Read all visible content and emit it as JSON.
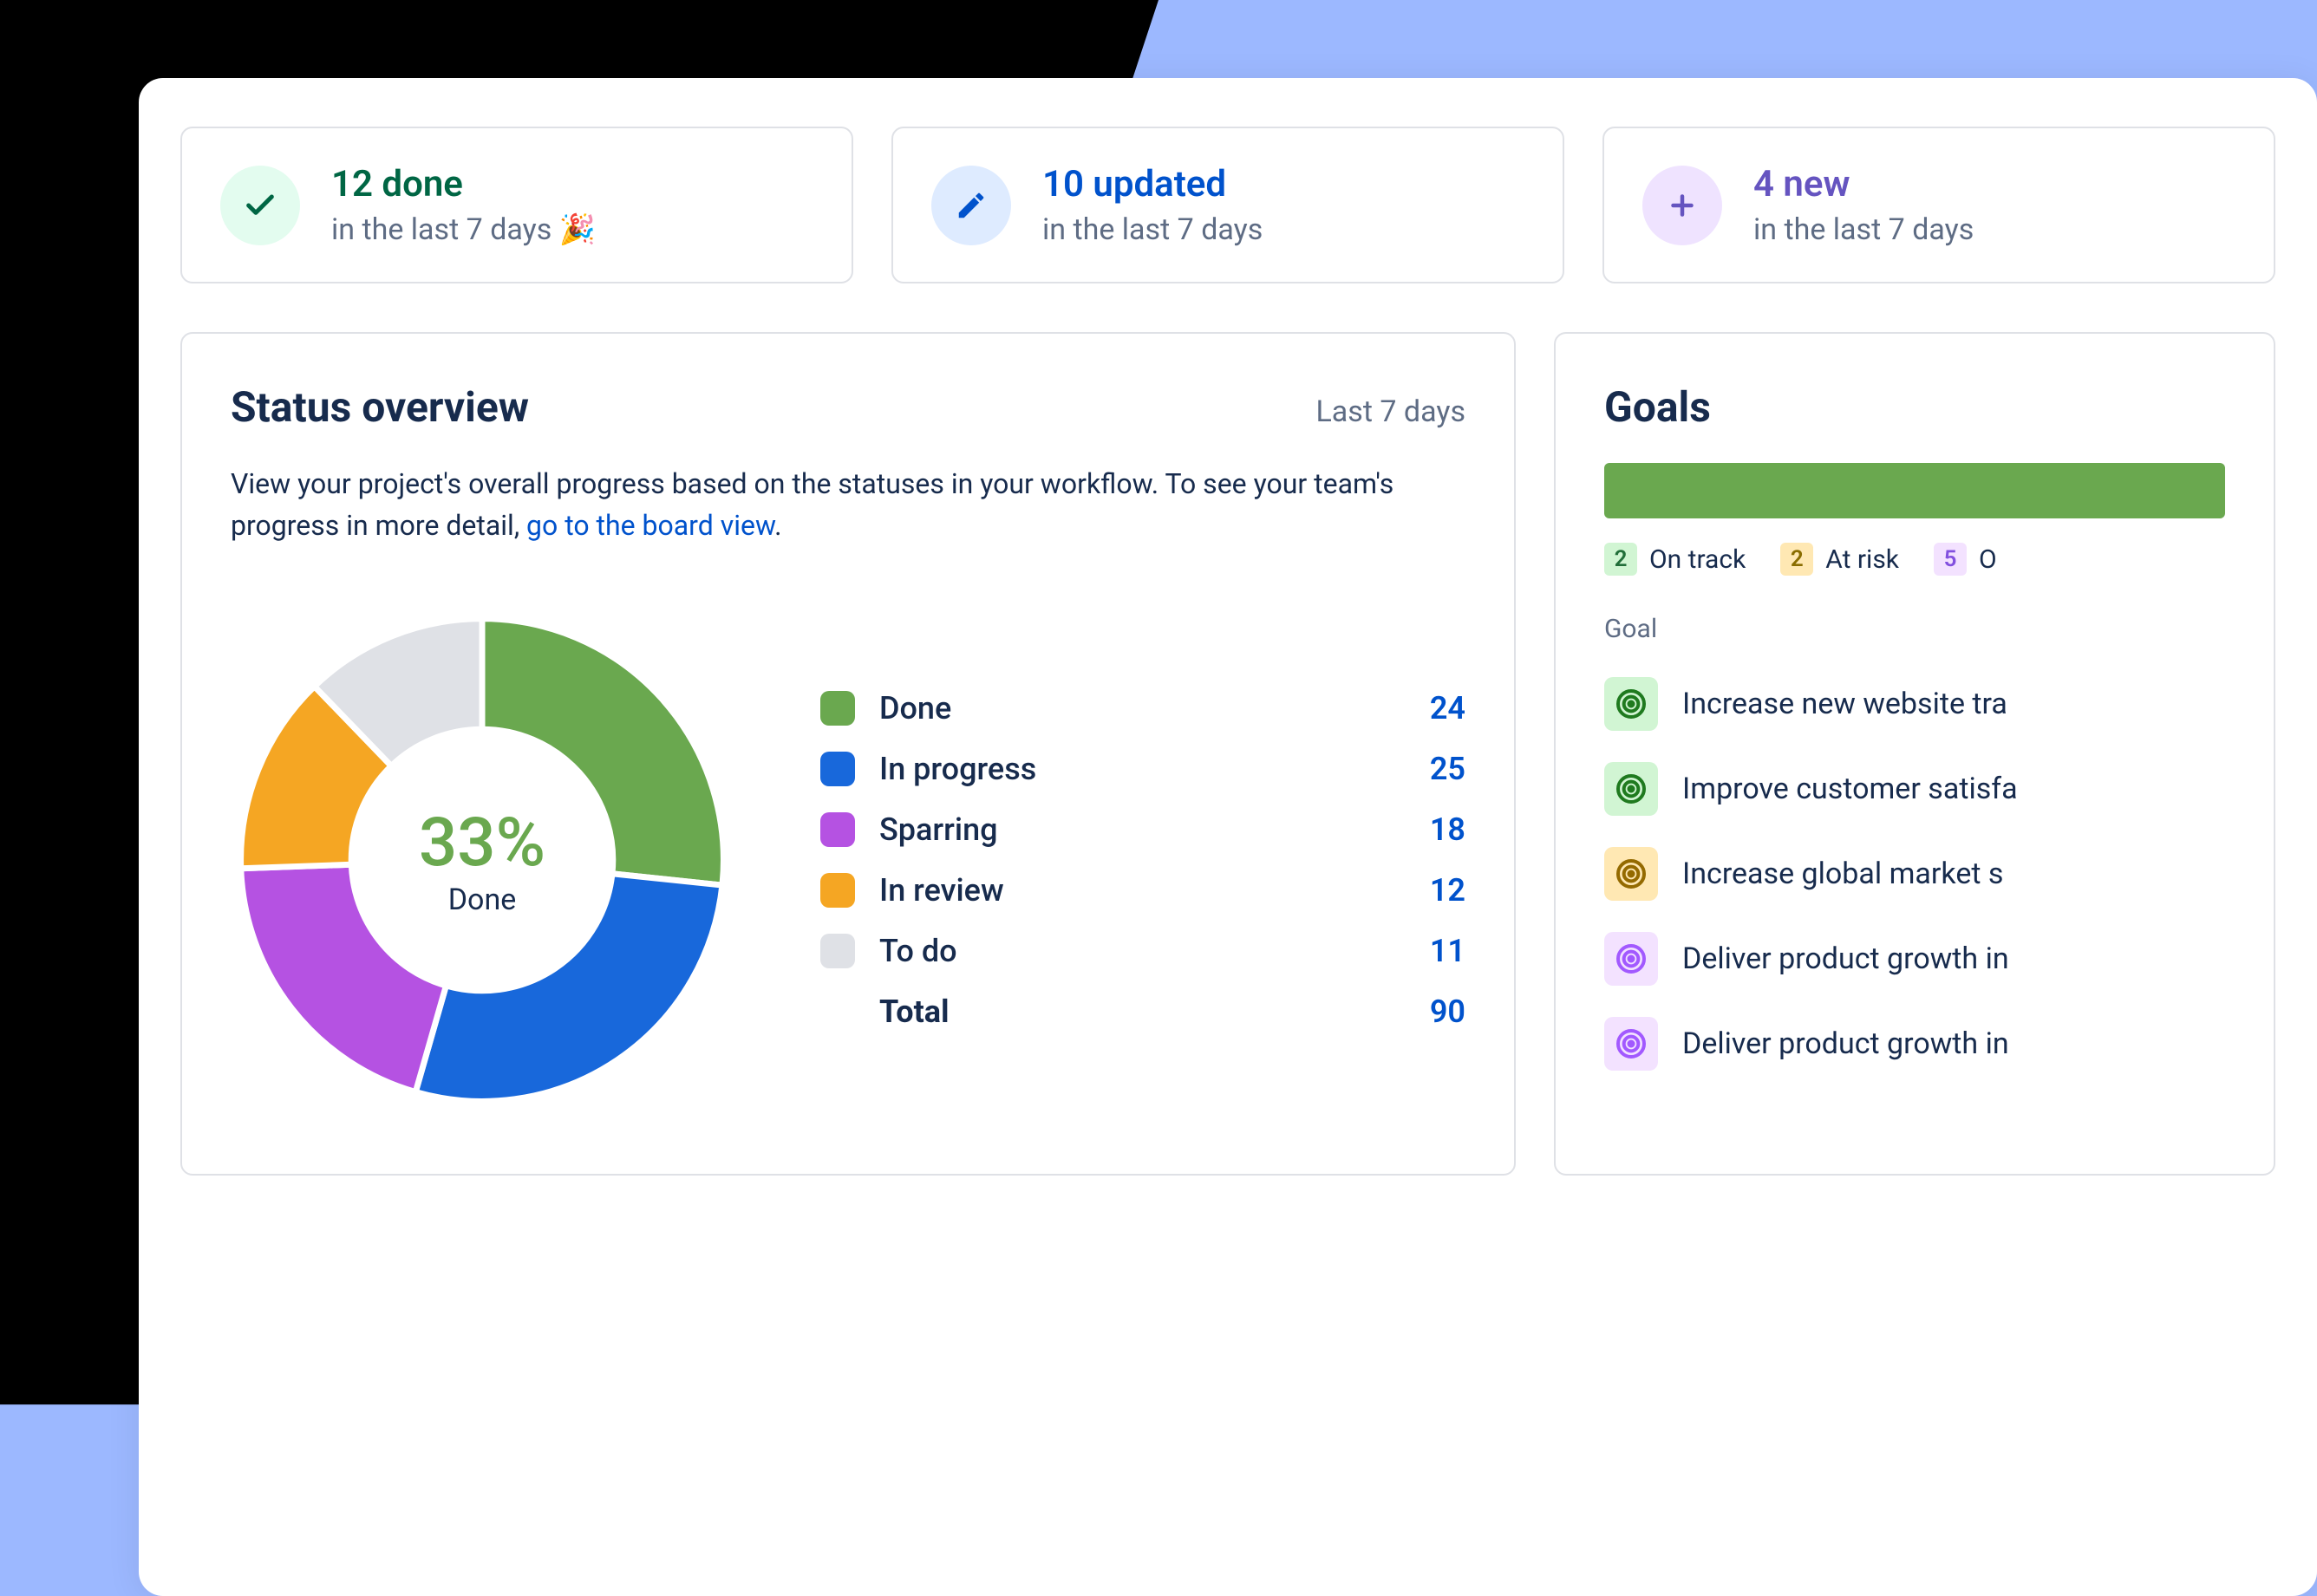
{
  "stats": [
    {
      "icon": "check",
      "iconClass": "icon-green",
      "title": "12 done",
      "titleClass": "t-green",
      "subtitle": "in the last 7 days 🎉"
    },
    {
      "icon": "pencil",
      "iconClass": "icon-blue",
      "title": "10 updated",
      "titleClass": "t-blue",
      "subtitle": "in the last 7 days"
    },
    {
      "icon": "plus",
      "iconClass": "icon-purple",
      "title": "4 new",
      "titleClass": "t-purple",
      "subtitle": "in the last 7 days"
    }
  ],
  "status": {
    "title": "Status overview",
    "range": "Last 7 days",
    "desc_pre": "View your project's overall progress based on the statuses in your workflow. To see your team's progress in more detail, ",
    "desc_link": "go to the board view",
    "desc_post": ".",
    "center_pct": "33%",
    "center_label": "Done"
  },
  "chart_data": {
    "type": "pie",
    "title": "Status overview",
    "series": [
      {
        "name": "Done",
        "value": 24,
        "color": "#6aa84f"
      },
      {
        "name": "In progress",
        "value": 25,
        "color": "#1868db"
      },
      {
        "name": "Sparring",
        "value": 18,
        "color": "#b552e2"
      },
      {
        "name": "In review",
        "value": 12,
        "color": "#f5a623"
      },
      {
        "name": "To do",
        "value": 11,
        "color": "#dfe1e6"
      }
    ],
    "total_label": "Total",
    "total_value": 90
  },
  "goals": {
    "title": "Goals",
    "summary": [
      {
        "count": "2",
        "label": "On track",
        "badgeClass": "b-green"
      },
      {
        "count": "2",
        "label": "At risk",
        "badgeClass": "b-yellow"
      },
      {
        "count": "5",
        "label": "O",
        "badgeClass": "b-purple"
      }
    ],
    "section_label": "Goal",
    "items": [
      {
        "iconClass": "g-green",
        "text": "Increase new website tra"
      },
      {
        "iconClass": "g-green",
        "text": "Improve customer satisfa"
      },
      {
        "iconClass": "g-yellow",
        "text": "Increase global market s"
      },
      {
        "iconClass": "g-purple",
        "text": "Deliver product growth in"
      },
      {
        "iconClass": "g-purple",
        "text": "Deliver product growth in"
      }
    ]
  }
}
